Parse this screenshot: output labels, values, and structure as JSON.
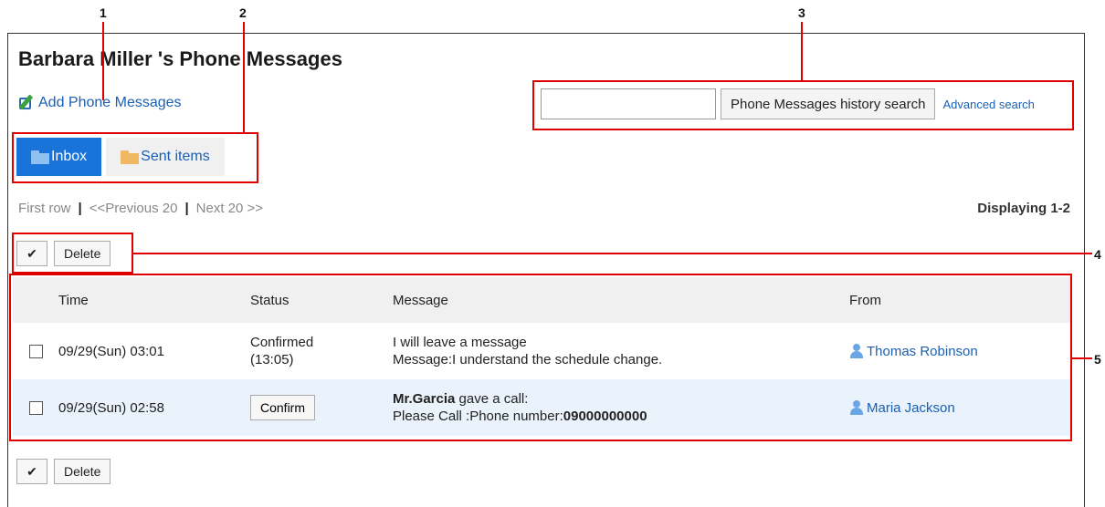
{
  "page": {
    "title": "Barbara Miller 's Phone Messages"
  },
  "actions": {
    "add_label": "Add Phone Messages"
  },
  "tabs": [
    {
      "label": "Inbox",
      "active": true
    },
    {
      "label": "Sent items",
      "active": false
    }
  ],
  "search": {
    "value": "",
    "button_label": "Phone Messages history search",
    "advanced_label": "Advanced search"
  },
  "pager": {
    "first": "First row",
    "sep": "|",
    "prev": "<<Previous 20",
    "next": "Next 20 >>",
    "displaying": "Displaying 1-2"
  },
  "bulk": {
    "check_label": "✔",
    "delete_label": "Delete"
  },
  "list": {
    "headers": {
      "time": "Time",
      "status": "Status",
      "message": "Message",
      "from": "From"
    },
    "rows": [
      {
        "time": "09/29(Sun) 03:01",
        "status_line1": "Confirmed",
        "status_line2": "(13:05)",
        "msg_line1": "I will leave a message",
        "msg_line2": "Message:I understand the schedule change.",
        "from": "Thomas Robinson"
      },
      {
        "time": "09/29(Sun) 02:58",
        "confirm_label": "Confirm",
        "caller": "Mr.Garcia",
        "msg_rest": " gave a call:",
        "phone_label": "Please Call :Phone number:",
        "phone_number": "09000000000",
        "from": "Maria Jackson"
      }
    ]
  },
  "callouts": {
    "n1": "1",
    "n2": "2",
    "n3": "3",
    "n4": "4",
    "n5": "5"
  },
  "colors": {
    "accent": "#1a73d9",
    "link": "#1a5fb4",
    "callout": "#e00000",
    "row_highlight": "#eaf3fb"
  }
}
